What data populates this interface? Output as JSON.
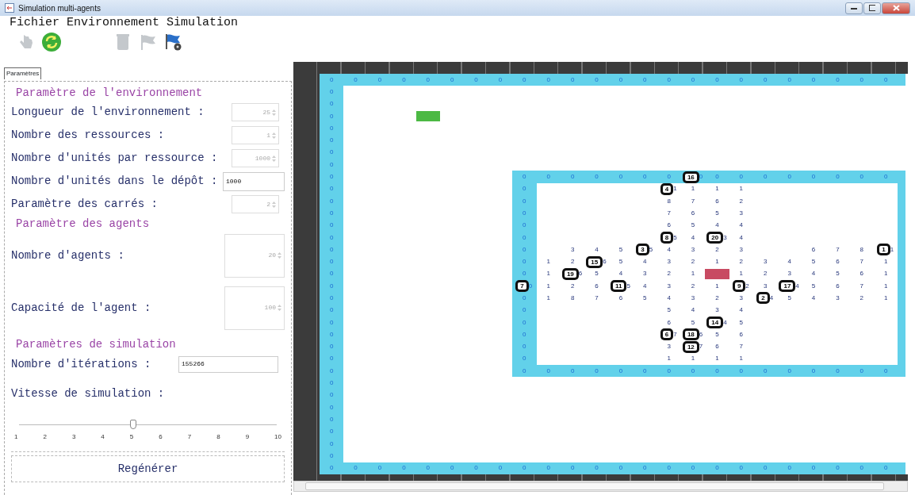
{
  "window": {
    "title": "Simulation multi-agents"
  },
  "menu": [
    "Fichier",
    "Environnement",
    "Simulation"
  ],
  "toolbar": [
    {
      "disabled": true
    },
    {
      "disabled": false
    },
    {
      "disabled": true
    },
    {
      "disabled": true
    },
    {
      "disabled": false
    }
  ],
  "tabs": [
    {
      "label": "Paramètres",
      "selected": true
    }
  ],
  "panel": [
    {
      "kind": "heading",
      "text": "Paramètre de l'environnement"
    },
    {
      "kind": "spinner",
      "label": "Longueur de l'environnement :",
      "value": "25",
      "disabled": true
    },
    {
      "kind": "spinner",
      "label": "Nombre des ressources :",
      "value": "1",
      "disabled": true
    },
    {
      "kind": "spinner",
      "label": "Nombre d'unités par ressource :",
      "value": "1000",
      "disabled": true
    },
    {
      "kind": "text",
      "label": "Nombre d'unités dans le dépôt :",
      "value": "1000",
      "disabled": false
    },
    {
      "kind": "spinner",
      "label": "Paramètre des carrés :",
      "value": "2",
      "disabled": true
    },
    {
      "kind": "heading",
      "text": "Paramètre des agents"
    },
    {
      "kind": "tall-spinner",
      "label": "Nombre d'agents :",
      "value": "20",
      "disabled": true
    },
    {
      "kind": "tall-spinner",
      "label": "Capacité de l'agent :",
      "value": "100",
      "disabled": true
    },
    {
      "kind": "heading",
      "text": "Paramètres de simulation"
    },
    {
      "kind": "wide-text",
      "label": "Nombre d'itérations :",
      "value": "155266",
      "disabled": false
    },
    {
      "kind": "slider",
      "label": "Vitesse de simulation :",
      "level": 0.444,
      "ticks": [
        "1",
        "2",
        "3",
        "4",
        "5",
        "6",
        "7",
        "8",
        "9",
        "10"
      ]
    },
    {
      "kind": "button",
      "text": "Regénérer"
    }
  ],
  "grid": {
    "rows": [
      [
        {
          "kind": "wall",
          "text": "0"
        },
        {
          "kind": "wall",
          "text": "0"
        },
        {
          "kind": "wall",
          "text": "0"
        },
        {
          "kind": "wall",
          "text": "0"
        },
        {
          "kind": "wall",
          "text": "0"
        },
        {
          "kind": "wall",
          "text": "0"
        },
        {
          "kind": "wall",
          "text": "0"
        },
        {
          "kind": "wall",
          "text": "0"
        },
        {
          "kind": "wall",
          "text": "0"
        },
        {
          "kind": "wall",
          "text": "0"
        },
        {
          "kind": "wall",
          "text": "0"
        },
        {
          "kind": "wall",
          "text": "0"
        },
        {
          "kind": "wall",
          "text": "0"
        },
        {
          "kind": "wall",
          "text": "0"
        },
        {
          "kind": "wall",
          "text": "0"
        },
        {
          "kind": "wall",
          "text": "0"
        },
        {
          "kind": "wall",
          "text": "0"
        },
        {
          "kind": "wall",
          "text": "0"
        },
        {
          "kind": "wall",
          "text": "0"
        },
        {
          "kind": "wall",
          "text": "0"
        },
        {
          "kind": "wall",
          "text": "0"
        },
        {
          "kind": "wall",
          "text": "0"
        },
        {
          "kind": "wall",
          "text": "0"
        },
        {
          "kind": "wall",
          "text": "0"
        },
        {
          "kind": "wall"
        }
      ],
      [
        {
          "kind": "wall",
          "text": "0"
        }
      ],
      [
        {
          "kind": "wall",
          "text": "0"
        }
      ],
      [
        {
          "kind": "wall",
          "text": "0"
        },
        null,
        null,
        null,
        {
          "kind": "depot"
        }
      ],
      [
        {
          "kind": "wall",
          "text": "0"
        }
      ],
      [
        {
          "kind": "wall",
          "text": "0"
        }
      ],
      [
        {
          "kind": "wall",
          "text": "0"
        }
      ],
      [
        {
          "kind": "wall",
          "text": "0"
        }
      ],
      [
        {
          "kind": "wall",
          "text": "0"
        },
        null,
        null,
        null,
        null,
        null,
        null,
        null,
        {
          "kind": "wall",
          "text": "0"
        },
        {
          "kind": "wall",
          "text": "0"
        },
        {
          "kind": "wall",
          "text": "0"
        },
        {
          "kind": "wall",
          "text": "0"
        },
        {
          "kind": "wall",
          "text": "0"
        },
        {
          "kind": "wall",
          "text": "0"
        },
        {
          "kind": "wall",
          "text": "0"
        },
        {
          "kind": "agent",
          "agent": "16",
          "text": "0",
          "on_wall": true
        },
        {
          "kind": "wall",
          "text": "0"
        },
        {
          "kind": "wall",
          "text": "0"
        },
        {
          "kind": "wall",
          "text": "0"
        },
        {
          "kind": "wall",
          "text": "0"
        },
        {
          "kind": "wall",
          "text": "0"
        },
        {
          "kind": "wall",
          "text": "0"
        },
        {
          "kind": "wall",
          "text": "0"
        },
        {
          "kind": "wall",
          "text": "0"
        },
        {
          "kind": "wall"
        }
      ],
      [
        {
          "kind": "wall",
          "text": "0"
        },
        null,
        null,
        null,
        null,
        null,
        null,
        null,
        {
          "kind": "wall",
          "text": "0"
        },
        null,
        null,
        null,
        null,
        null,
        {
          "kind": "agent",
          "agent": "4",
          "text": "1",
          "on_wall": false
        },
        "1",
        "1",
        "1",
        null,
        null,
        null,
        null,
        null,
        null,
        {
          "kind": "wall"
        }
      ],
      [
        {
          "kind": "wall",
          "text": "0"
        },
        null,
        null,
        null,
        null,
        null,
        null,
        null,
        {
          "kind": "wall",
          "text": "0"
        },
        null,
        null,
        null,
        null,
        null,
        "8",
        "7",
        "6",
        "2",
        null,
        null,
        null,
        null,
        null,
        null,
        {
          "kind": "wall"
        }
      ],
      [
        {
          "kind": "wall",
          "text": "0"
        },
        null,
        null,
        null,
        null,
        null,
        null,
        null,
        {
          "kind": "wall",
          "text": "0"
        },
        null,
        null,
        null,
        null,
        null,
        "7",
        "6",
        "5",
        "3",
        null,
        null,
        null,
        null,
        null,
        null,
        {
          "kind": "wall"
        }
      ],
      [
        {
          "kind": "wall",
          "text": "0"
        },
        null,
        null,
        null,
        null,
        null,
        null,
        null,
        {
          "kind": "wall",
          "text": "0"
        },
        null,
        null,
        null,
        null,
        null,
        "6",
        "5",
        "4",
        "4",
        null,
        null,
        null,
        null,
        null,
        null,
        {
          "kind": "wall"
        }
      ],
      [
        {
          "kind": "wall",
          "text": "0"
        },
        null,
        null,
        null,
        null,
        null,
        null,
        null,
        {
          "kind": "wall",
          "text": "0"
        },
        null,
        null,
        null,
        null,
        null,
        {
          "kind": "agent",
          "agent": "8",
          "text": "5",
          "on_wall": false
        },
        "4",
        {
          "kind": "agent",
          "agent": "20",
          "text": "3",
          "on_wall": false
        },
        "4",
        null,
        null,
        null,
        null,
        null,
        null,
        {
          "kind": "wall"
        }
      ],
      [
        {
          "kind": "wall",
          "text": "0"
        },
        null,
        null,
        null,
        null,
        null,
        null,
        null,
        {
          "kind": "wall",
          "text": "0"
        },
        null,
        "3",
        "4",
        "5",
        {
          "kind": "agent",
          "agent": "3",
          "text": "5",
          "on_wall": false
        },
        "4",
        "3",
        "2",
        "3",
        null,
        null,
        "6",
        "7",
        "8",
        {
          "kind": "agent",
          "agent": "1",
          "text": "1",
          "on_wall": false
        },
        {
          "kind": "wall"
        }
      ],
      [
        {
          "kind": "wall",
          "text": "0"
        },
        null,
        null,
        null,
        null,
        null,
        null,
        null,
        {
          "kind": "wall",
          "text": "0"
        },
        "1",
        "2",
        {
          "kind": "agent",
          "agent": "15",
          "text": "6",
          "on_wall": false
        },
        "5",
        "4",
        "3",
        "2",
        "1",
        "2",
        "3",
        "4",
        "5",
        "6",
        "7",
        "1",
        {
          "kind": "wall"
        }
      ],
      [
        {
          "kind": "wall",
          "text": "0"
        },
        null,
        null,
        null,
        null,
        null,
        null,
        null,
        {
          "kind": "wall",
          "text": "0"
        },
        "1",
        {
          "kind": "agent",
          "agent": "19",
          "text": "6",
          "on_wall": false
        },
        "5",
        "4",
        "3",
        "2",
        "1",
        {
          "kind": "resource"
        },
        "1",
        "2",
        "3",
        "4",
        "5",
        "6",
        "1",
        {
          "kind": "wall"
        }
      ],
      [
        {
          "kind": "wall",
          "text": "0"
        },
        null,
        null,
        null,
        null,
        null,
        null,
        null,
        {
          "kind": "agent",
          "agent": "7",
          "text": "0",
          "on_wall": true
        },
        "1",
        "2",
        "6",
        {
          "kind": "agent",
          "agent": "11",
          "text": "5",
          "on_wall": false
        },
        "4",
        "3",
        "2",
        "1",
        {
          "kind": "agent",
          "agent": "9",
          "text": "2",
          "on_wall": false
        },
        "3",
        {
          "kind": "agent",
          "agent": "17",
          "text": "4",
          "on_wall": false
        },
        "5",
        "6",
        "7",
        "1",
        {
          "kind": "wall"
        }
      ],
      [
        {
          "kind": "wall",
          "text": "0"
        },
        null,
        null,
        null,
        null,
        null,
        null,
        null,
        {
          "kind": "wall",
          "text": "0"
        },
        "1",
        "8",
        "7",
        "6",
        "5",
        "4",
        "3",
        "2",
        "3",
        {
          "kind": "agent",
          "agent": "2",
          "text": "4",
          "on_wall": false
        },
        "5",
        "4",
        "3",
        "2",
        "1",
        {
          "kind": "wall"
        }
      ],
      [
        {
          "kind": "wall",
          "text": "0"
        },
        null,
        null,
        null,
        null,
        null,
        null,
        null,
        {
          "kind": "wall",
          "text": "0"
        },
        null,
        null,
        null,
        null,
        null,
        "5",
        "4",
        "3",
        "4",
        null,
        null,
        null,
        null,
        null,
        null,
        {
          "kind": "wall"
        }
      ],
      [
        {
          "kind": "wall",
          "text": "0"
        },
        null,
        null,
        null,
        null,
        null,
        null,
        null,
        {
          "kind": "wall",
          "text": "0"
        },
        null,
        null,
        null,
        null,
        null,
        "6",
        "5",
        {
          "kind": "agent",
          "agent": "14",
          "text": "4",
          "on_wall": false
        },
        "5",
        null,
        null,
        null,
        null,
        null,
        null,
        {
          "kind": "wall"
        }
      ],
      [
        {
          "kind": "wall",
          "text": "0"
        },
        null,
        null,
        null,
        null,
        null,
        null,
        null,
        {
          "kind": "wall",
          "text": "0"
        },
        null,
        null,
        null,
        null,
        null,
        {
          "kind": "agent",
          "agent": "6",
          "text": "7",
          "on_wall": false
        },
        {
          "kind": "agent",
          "agent": "18",
          "text": "6",
          "on_wall": false
        },
        "5",
        "6",
        null,
        null,
        null,
        null,
        null,
        null,
        {
          "kind": "wall"
        }
      ],
      [
        {
          "kind": "wall",
          "text": "0"
        },
        null,
        null,
        null,
        null,
        null,
        null,
        null,
        {
          "kind": "wall",
          "text": "0"
        },
        null,
        null,
        null,
        null,
        null,
        "3",
        {
          "kind": "agent",
          "agent": "12",
          "text": "7",
          "on_wall": false
        },
        "6",
        "7",
        null,
        null,
        null,
        null,
        null,
        null,
        {
          "kind": "wall"
        }
      ],
      [
        {
          "kind": "wall",
          "text": "0"
        },
        null,
        null,
        null,
        null,
        null,
        null,
        null,
        {
          "kind": "wall",
          "text": "0"
        },
        null,
        null,
        null,
        null,
        null,
        "1",
        "1",
        "1",
        "1",
        null,
        null,
        null,
        null,
        null,
        null,
        {
          "kind": "wall"
        }
      ],
      [
        {
          "kind": "wall",
          "text": "0"
        },
        null,
        null,
        null,
        null,
        null,
        null,
        null,
        {
          "kind": "wall",
          "text": "0"
        },
        {
          "kind": "wall",
          "text": "0"
        },
        {
          "kind": "wall",
          "text": "0"
        },
        {
          "kind": "wall",
          "text": "0"
        },
        {
          "kind": "wall",
          "text": "0"
        },
        {
          "kind": "wall",
          "text": "0"
        },
        {
          "kind": "wall",
          "text": "0"
        },
        {
          "kind": "wall",
          "text": "0"
        },
        {
          "kind": "wall",
          "text": "0"
        },
        {
          "kind": "wall",
          "text": "0"
        },
        {
          "kind": "wall",
          "text": "0"
        },
        {
          "kind": "wall",
          "text": "0"
        },
        {
          "kind": "wall",
          "text": "0"
        },
        {
          "kind": "wall",
          "text": "0"
        },
        {
          "kind": "wall",
          "text": "0"
        },
        {
          "kind": "wall",
          "text": "0"
        },
        {
          "kind": "wall"
        }
      ],
      [
        {
          "kind": "wall",
          "text": "0"
        }
      ],
      [
        {
          "kind": "wall",
          "text": "0"
        }
      ],
      [
        {
          "kind": "wall",
          "text": "0"
        }
      ],
      [
        {
          "kind": "wall",
          "text": "0"
        }
      ],
      [
        {
          "kind": "wall",
          "text": "0"
        }
      ],
      [
        {
          "kind": "wall",
          "text": "0"
        }
      ],
      [
        {
          "kind": "wall",
          "text": "0"
        }
      ],
      [
        {
          "kind": "wall",
          "text": "0"
        },
        {
          "kind": "wall",
          "text": "0"
        },
        {
          "kind": "wall",
          "text": "0"
        },
        {
          "kind": "wall",
          "text": "0"
        },
        {
          "kind": "wall",
          "text": "0"
        },
        {
          "kind": "wall",
          "text": "0"
        },
        {
          "kind": "wall",
          "text": "0"
        },
        {
          "kind": "wall",
          "text": "0"
        },
        {
          "kind": "wall",
          "text": "0"
        },
        {
          "kind": "wall",
          "text": "0"
        },
        {
          "kind": "wall",
          "text": "0"
        },
        {
          "kind": "wall",
          "text": "0"
        },
        {
          "kind": "wall",
          "text": "0"
        },
        {
          "kind": "wall",
          "text": "0"
        },
        {
          "kind": "wall",
          "text": "0"
        },
        {
          "kind": "wall",
          "text": "0"
        },
        {
          "kind": "wall",
          "text": "0"
        },
        {
          "kind": "wall",
          "text": "0"
        },
        {
          "kind": "wall",
          "text": "0"
        },
        {
          "kind": "wall",
          "text": "0"
        },
        {
          "kind": "wall",
          "text": "0"
        },
        {
          "kind": "wall",
          "text": "0"
        },
        {
          "kind": "wall",
          "text": "0"
        },
        {
          "kind": "wall",
          "text": "0"
        },
        {
          "kind": "wall"
        }
      ]
    ]
  }
}
